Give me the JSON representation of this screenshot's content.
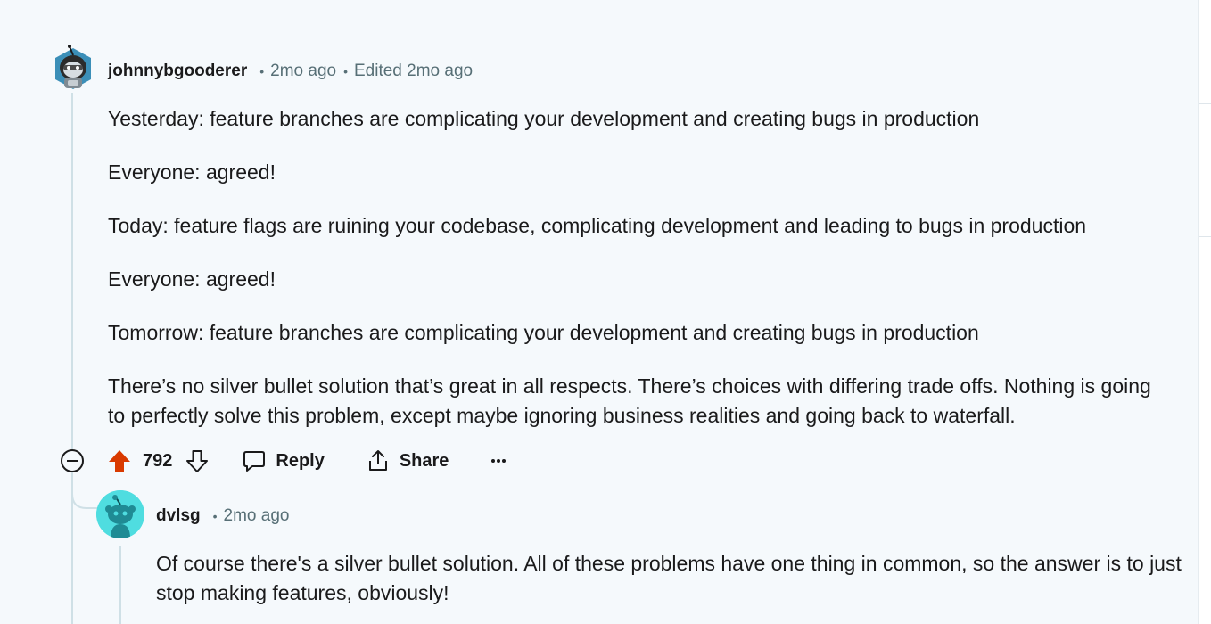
{
  "colors": {
    "background": "#f5f9fc",
    "upvote_active": "#d93a00",
    "meta": "#576f76",
    "thread_line": "#cfe0e6"
  },
  "comment": {
    "author": "johnnybgooderer",
    "age": "2mo ago",
    "edited": "Edited 2mo ago",
    "paragraphs": [
      "Yesterday: feature branches are complicating your development and creating bugs in production",
      "Everyone: agreed!",
      "Today: feature flags are ruining your codebase, complicating development and leading to bugs in production",
      "Everyone: agreed!",
      "Tomorrow: feature branches are complicating your development and creating bugs in production",
      "There’s no silver bullet solution that’s great in all respects. There’s choices with differing trade offs. Nothing is going to perfectly solve this problem, except maybe ignoring business realities and going back to waterfall."
    ],
    "actions": {
      "score": "792",
      "upvote_icon": "upvote-arrow-icon",
      "downvote_icon": "downvote-arrow-icon",
      "reply_label": "Reply",
      "share_label": "Share",
      "more_icon": "more-dots-icon",
      "collapse_icon": "collapse-minus-icon"
    }
  },
  "reply": {
    "author": "dvlsg",
    "age": "2mo ago",
    "paragraphs": [
      "Of course there's a silver bullet solution. All of these problems have one thing in common, so the answer is to just stop making features, obviously!"
    ]
  }
}
